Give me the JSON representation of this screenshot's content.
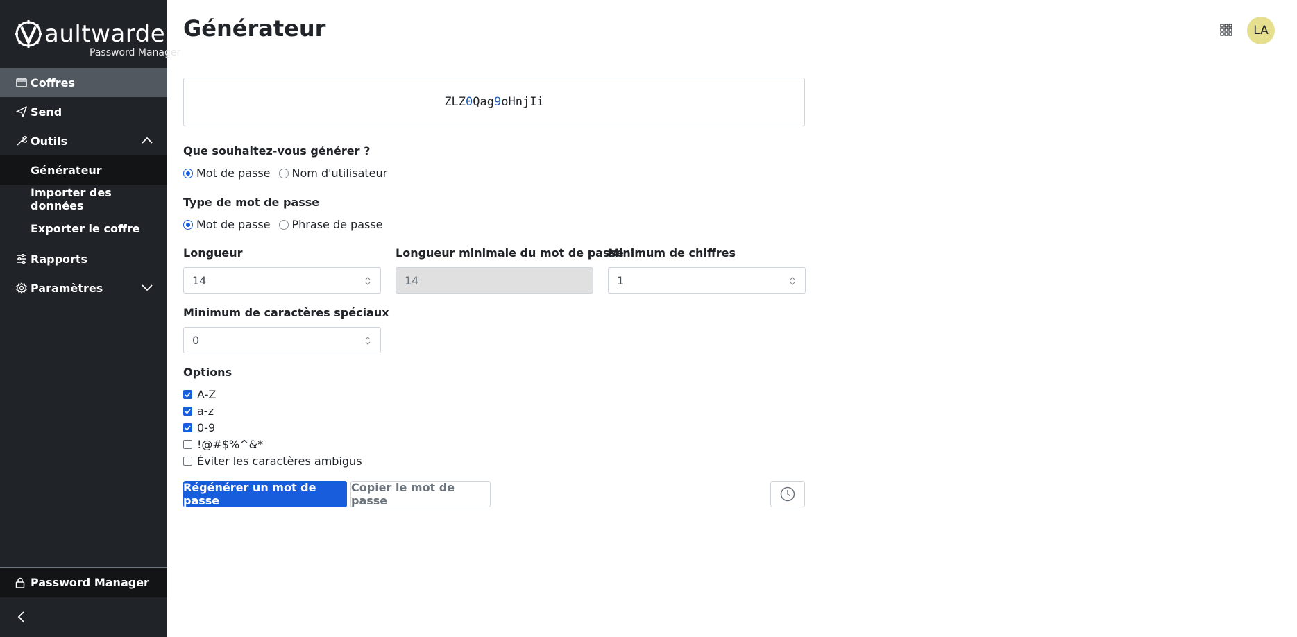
{
  "brand": {
    "name": "aultwarden",
    "sub": "Password Manager"
  },
  "sidebar": {
    "items": [
      {
        "label": "Coffres",
        "icon": "vault-icon"
      },
      {
        "label": "Send",
        "icon": "send-icon"
      },
      {
        "label": "Outils",
        "icon": "wrench-icon"
      },
      {
        "label": "Générateur"
      },
      {
        "label": "Importer des données"
      },
      {
        "label": "Exporter le coffre"
      },
      {
        "label": "Rapports",
        "icon": "sliders-icon"
      },
      {
        "label": "Paramètres",
        "icon": "gear-icon"
      }
    ],
    "bottom_label": "Password Manager"
  },
  "header": {
    "title": "Générateur",
    "avatar_initials": "LA"
  },
  "password": {
    "part1": "ZLZ",
    "digit1": "0",
    "part2": "Qag",
    "digit2": "9",
    "part3": "oHnjIi"
  },
  "what_to_generate": {
    "label": "Que souhaitez-vous générer ?",
    "options": [
      "Mot de passe",
      "Nom d'utilisateur"
    ],
    "selected": "Mot de passe"
  },
  "password_type": {
    "label": "Type de mot de passe",
    "options": [
      "Mot de passe",
      "Phrase de passe"
    ],
    "selected": "Mot de passe"
  },
  "fields": {
    "length": {
      "label": "Longueur",
      "value": "14"
    },
    "min_length": {
      "label": "Longueur minimale du mot de passe",
      "value": "14"
    },
    "min_digits": {
      "label": "Minimum de chiffres",
      "value": "1"
    },
    "min_special": {
      "label": "Minimum de caractères spéciaux",
      "value": "0"
    }
  },
  "options": {
    "label": "Options",
    "items": [
      {
        "label": "A-Z",
        "checked": true
      },
      {
        "label": "a-z",
        "checked": true
      },
      {
        "label": "0-9",
        "checked": true
      },
      {
        "label": "!@#$%^&*",
        "checked": false
      },
      {
        "label": "Éviter les caractères ambigus",
        "checked": false
      }
    ]
  },
  "buttons": {
    "regenerate": "Régénérer un mot de passe",
    "copy": "Copier le mot de passe"
  },
  "colors": {
    "sidebar": "#202428",
    "primary": "#175ddc",
    "avatar": "#e6df8e"
  }
}
